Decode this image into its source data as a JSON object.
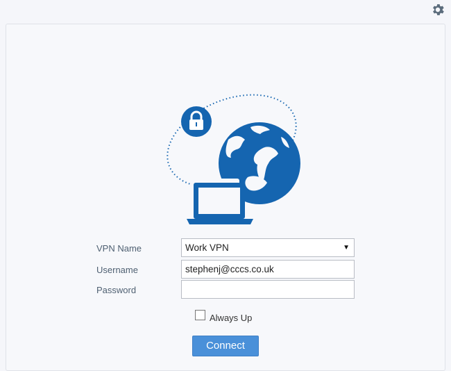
{
  "toolbar": {
    "settings_icon": "gear-icon"
  },
  "illustration": {
    "icons": [
      "lock-icon",
      "globe-icon",
      "laptop-icon"
    ],
    "accent_color": "#1565b0"
  },
  "form": {
    "vpn_name_label": "VPN Name",
    "vpn_name_value": "Work VPN",
    "username_label": "Username",
    "username_value": "stephenj@cccs.co.uk",
    "password_label": "Password",
    "password_value": "",
    "always_up_label": "Always Up",
    "always_up_checked": false,
    "connect_label": "Connect"
  },
  "colors": {
    "button": "#4a90d9",
    "label_text": "#4f6072",
    "gear": "#5b6c7c"
  }
}
